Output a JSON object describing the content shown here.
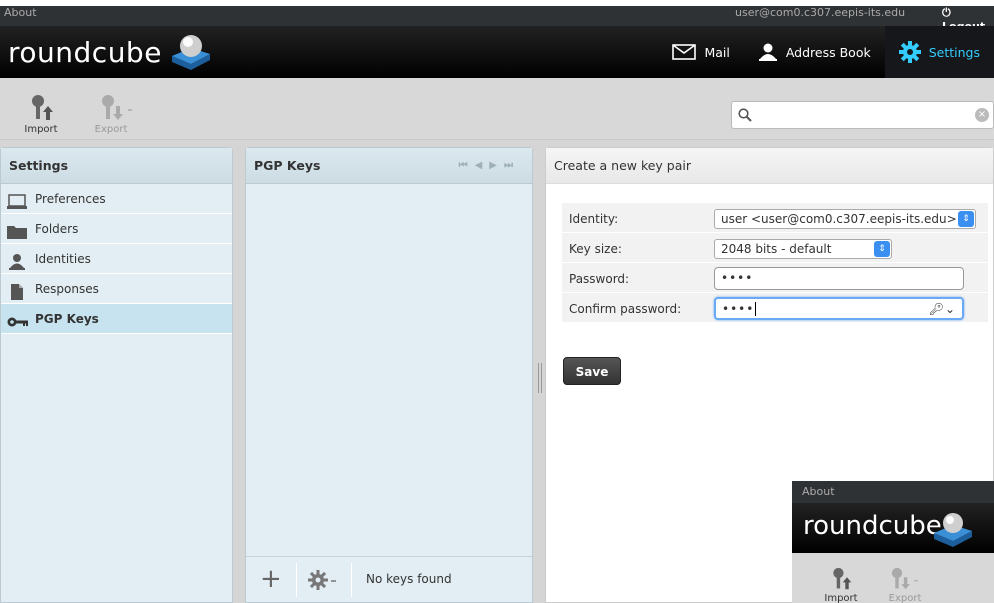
{
  "topbar": {
    "about": "About",
    "user": "user@com0.c307.eepis-its.edu",
    "logout": "Logout"
  },
  "header": {
    "logo": "roundcube",
    "tasks": [
      {
        "label": "Mail",
        "icon": "envelope-icon"
      },
      {
        "label": "Address Book",
        "icon": "person-icon"
      },
      {
        "label": "Settings",
        "icon": "gear-icon",
        "active": true
      }
    ]
  },
  "toolbar": {
    "import_label": "Import",
    "export_label": "Export",
    "search_placeholder": ""
  },
  "settings_panel": {
    "title": "Settings",
    "items": [
      {
        "label": "Preferences",
        "icon": "monitor-icon"
      },
      {
        "label": "Folders",
        "icon": "folder-icon"
      },
      {
        "label": "Identities",
        "icon": "person-icon"
      },
      {
        "label": "Responses",
        "icon": "document-icon"
      },
      {
        "label": "PGP Keys",
        "icon": "key-icon",
        "selected": true
      }
    ]
  },
  "pgp_panel": {
    "title": "PGP Keys",
    "status": "No keys found"
  },
  "content": {
    "title": "Create a new key pair",
    "identity_label": "Identity:",
    "identity_value": "user <user@com0.c307.eepis-its.edu>",
    "keysize_label": "Key size:",
    "keysize_value": "2048 bits - default",
    "password_label": "Password:",
    "password_value": "••••",
    "confirm_label": "Confirm password:",
    "confirm_value": "••••",
    "save_label": "Save"
  },
  "thumbnail": {
    "about": "About",
    "logo": "roundcube",
    "import_label": "Import",
    "export_label": "Export"
  },
  "colors": {
    "header_bg": "#000000",
    "active_task": "#33ccff",
    "panel_bg": "#e2eef3",
    "selected_row": "#c7e3ef",
    "focus_ring": "#6aaaf4"
  }
}
